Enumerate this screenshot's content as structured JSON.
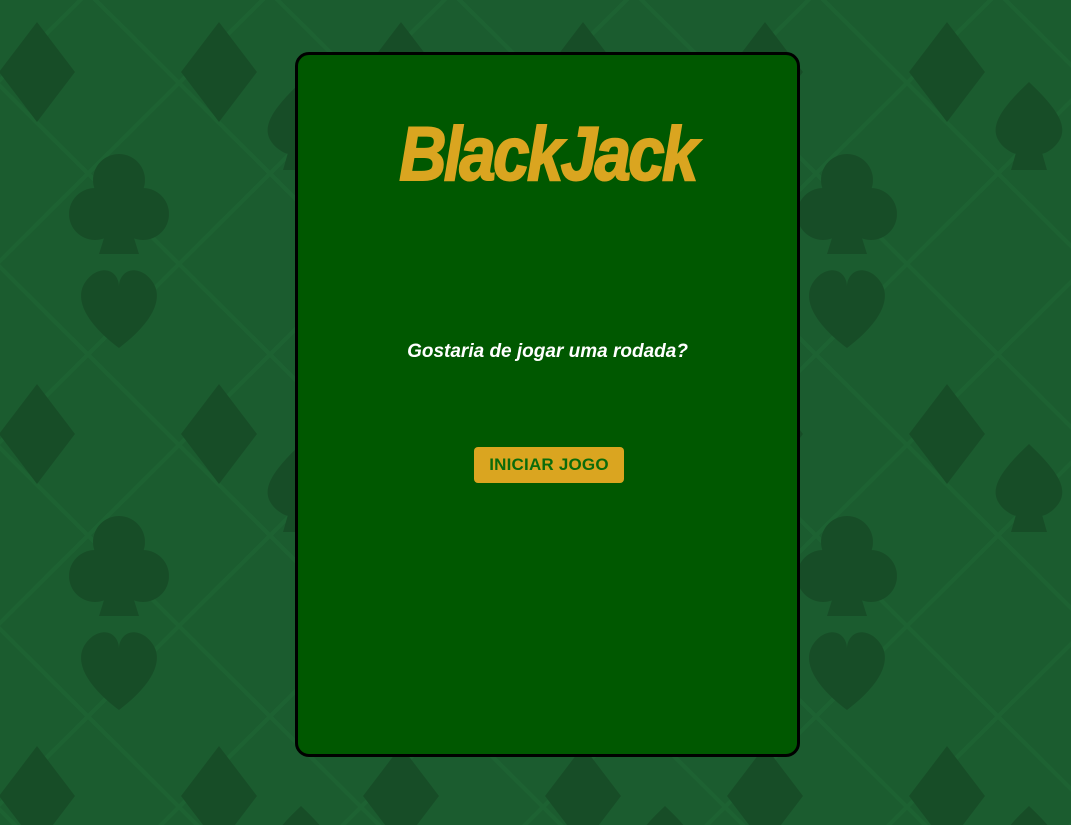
{
  "game": {
    "title": "BlackJack",
    "prompt": "Gostaria de jogar uma rodada?",
    "start_button_label": "INICIAR JOGO"
  },
  "background": {
    "pattern_icons": [
      "diamond-icon",
      "club-icon",
      "heart-icon",
      "spade-icon"
    ]
  },
  "colors": {
    "table_green": "#005800",
    "background_green": "#1b5c2f",
    "pattern_dark": "#174d27",
    "gold": "#daa520",
    "button_text": "#0b6b0b",
    "panel_border": "#000000"
  }
}
